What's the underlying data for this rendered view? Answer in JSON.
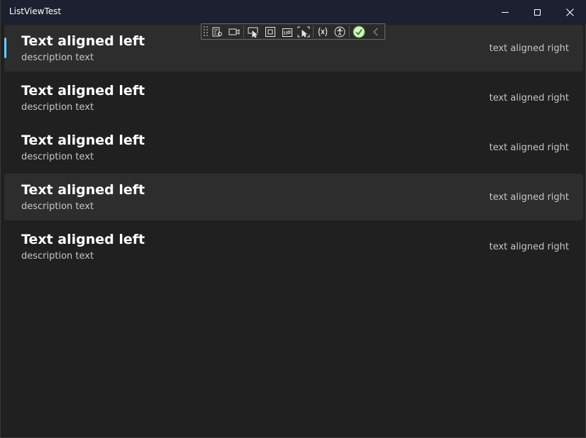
{
  "window": {
    "title": "ListViewTest"
  },
  "toolbar": {
    "icons": [
      "go-to-live-visual-tree-icon",
      "track-focus-icon",
      "select-element-icon",
      "display-layout-adorners-icon",
      "preview-selection-icon",
      "toggle-hot-reload-icon",
      "binding-failures-icon",
      "accessibility-checker-icon",
      "check-icon",
      "collapse-icon"
    ]
  },
  "list": {
    "items": [
      {
        "title": "Text aligned left",
        "description": "description text",
        "right": "text aligned right"
      },
      {
        "title": "Text aligned left",
        "description": "description text",
        "right": "text aligned right"
      },
      {
        "title": "Text aligned left",
        "description": "description text",
        "right": "text aligned right"
      },
      {
        "title": "Text aligned left",
        "description": "description text",
        "right": "text aligned right"
      },
      {
        "title": "Text aligned left",
        "description": "description text",
        "right": "text aligned right"
      }
    ]
  },
  "colors": {
    "accent": "#60cdff",
    "background": "#202020",
    "titlebar": "#1c2030",
    "row_highlight": "#2d2d2d"
  }
}
